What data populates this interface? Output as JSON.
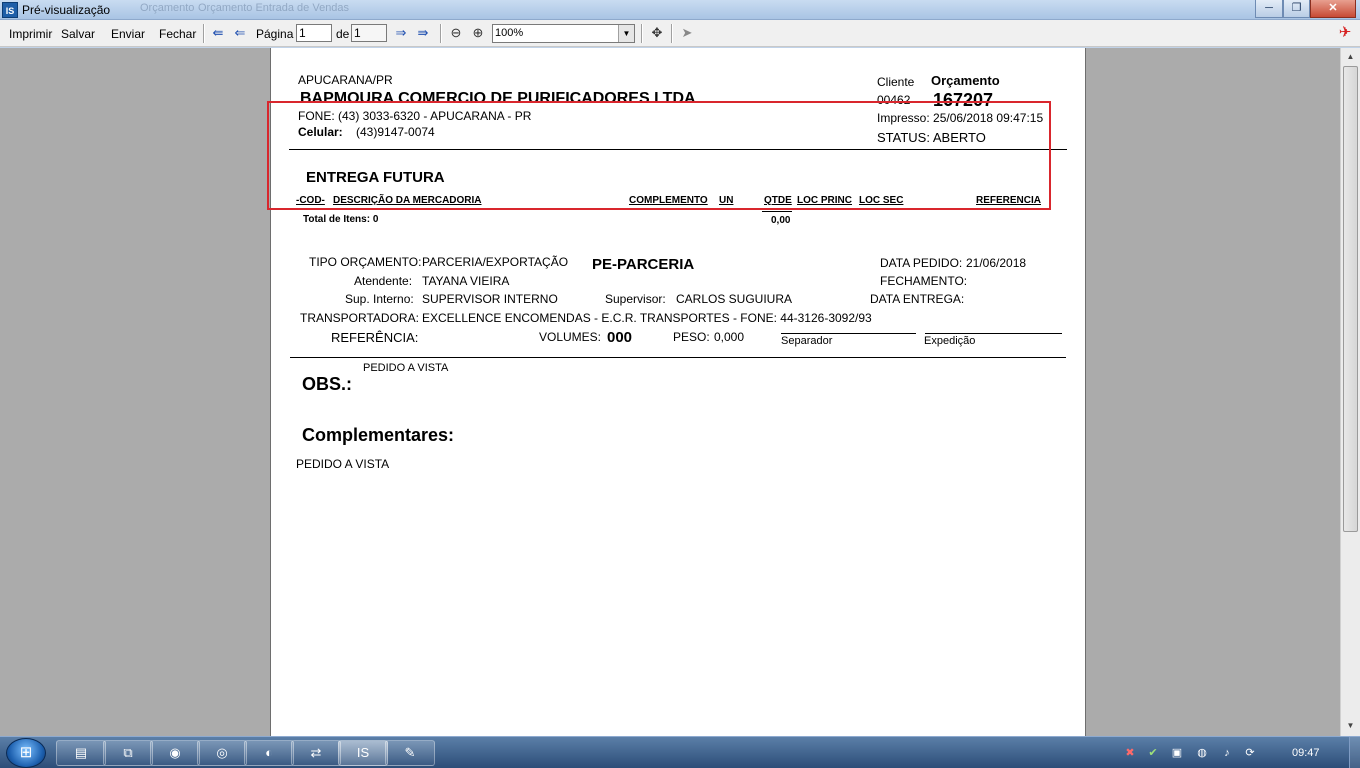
{
  "window": {
    "title": "Pré-visualização",
    "app_icon_text": "IS",
    "background_tab_1": "Orçamento",
    "background_tab_2": "Orçamento Entrada de Vendas",
    "minimize_glyph": "─",
    "maximize_glyph": "❐",
    "close_glyph": "✕"
  },
  "toolbar": {
    "print_label": "Imprimir",
    "save_label": "Salvar",
    "send_label": "Enviar",
    "close_label": "Fechar",
    "page_label": "Página",
    "page_value": "1",
    "of_label": "de",
    "total_pages": "1",
    "zoom_value": "100%",
    "icons": [
      "first-page-icon",
      "prev-page-icon",
      "next-page-icon",
      "last-page-icon",
      "zoom-out-icon",
      "zoom-in-icon",
      "move-icon",
      "pointer-icon"
    ]
  },
  "report": {
    "city": "APUCARANA/PR",
    "company": "BAPMOURA COMERCIO DE PURIFICADORES LTDA",
    "phone": "FONE: (43) 3033-6320 - APUCARANA - PR",
    "mobile_label": "Celular:",
    "mobile": "(43)9147-0074",
    "client_label": "Cliente",
    "client_code": "00462",
    "quote_label": "Orçamento",
    "quote_number": "167207",
    "printed": "Impresso: 25/06/2018 09:47:15",
    "status": "STATUS: ABERTO",
    "section_title": "ENTREGA FUTURA",
    "columns": [
      "-COD-",
      "DESCRIÇÃO DA MERCADORIA",
      "COMPLEMENTO",
      "UN",
      "QTDE",
      "LOC PRINC",
      "LOC SEC",
      "REFERENCIA"
    ],
    "total_items": "Total de Itens: 0",
    "total_qty": "0,00",
    "type_label": "TIPO ORÇAMENTO:",
    "type_value": "PARCERIA/EXPORTAÇÃO",
    "pe_value": "PE-PARCERIA",
    "order_date_label": "DATA PEDIDO:",
    "order_date": "21/06/2018",
    "attendant_label": "Atendente:",
    "attendant": "TAYANA VIEIRA",
    "closing_label": "FECHAMENTO:",
    "internal_sup_label": "Sup. Interno:",
    "internal_sup": "SUPERVISOR INTERNO",
    "supervisor_label": "Supervisor:",
    "supervisor": "CARLOS SUGUIURA",
    "delivery_date_label": "DATA ENTREGA:",
    "carrier_label": "TRANSPORTADORA:",
    "carrier": "EXCELLENCE ENCOMENDAS - E.C.R. TRANSPORTES - FONE: 44-3126-3092/93",
    "reference_label": "REFERÊNCIA:",
    "volumes_label": "VOLUMES:",
    "volumes": "000",
    "weight_label": "PESO:",
    "weight": "0,000",
    "separator_label": "Separador",
    "dispatch_label": "Expedição",
    "obs_small": "PEDIDO A VISTA",
    "obs_label": "OBS.:",
    "complementary_label": "Complementares:",
    "complementary_text": "PEDIDO A VISTA"
  },
  "taskbar": {
    "clock": "09:47",
    "active_app_text": "IS",
    "highlight_color": "#d9262d"
  }
}
